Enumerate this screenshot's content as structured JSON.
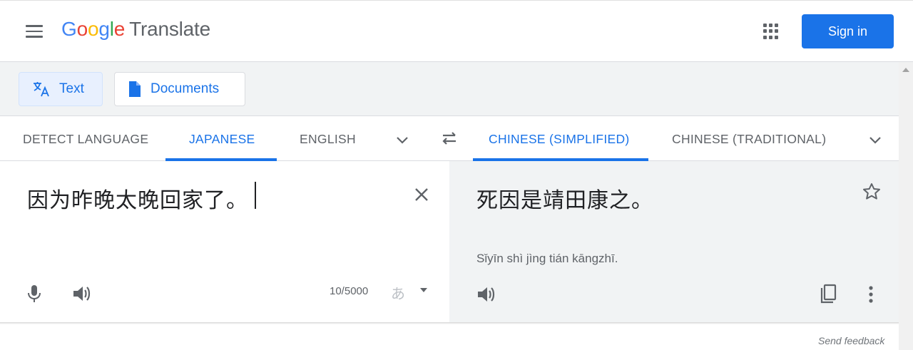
{
  "header": {
    "logo": {
      "g1": "G",
      "g2": "o",
      "g3": "o",
      "g4": "g",
      "g5": "l",
      "g6": "e",
      "product": "Translate"
    },
    "sign_in_label": "Sign in",
    "icons": {
      "menu": "hamburger-menu-icon",
      "apps": "apps-grid-icon"
    }
  },
  "modes": [
    {
      "label": "Text",
      "icon": "translate-icon",
      "active": true
    },
    {
      "label": "Documents",
      "icon": "document-icon",
      "active": false
    }
  ],
  "source_languages": [
    {
      "label": "DETECT LANGUAGE",
      "active": false
    },
    {
      "label": "JAPANESE",
      "active": true
    },
    {
      "label": "ENGLISH",
      "active": false
    }
  ],
  "target_languages": [
    {
      "label": "CHINESE (SIMPLIFIED)",
      "active": true
    },
    {
      "label": "CHINESE (TRADITIONAL)",
      "active": false
    }
  ],
  "source": {
    "text": "因为昨晚太晚回家了。",
    "char_count": "10/5000",
    "ime_label": "あ"
  },
  "target": {
    "text": "死因是靖田康之。",
    "romanization": "Sǐyīn shì jìng tián kāngzhī."
  },
  "footer": {
    "feedback_label": "Send feedback"
  },
  "colors": {
    "accent": "#1a73e8",
    "active_bg": "#e8f0fe",
    "panel_bg": "#f1f3f4",
    "text": "#3c4043",
    "muted": "#5f6368"
  }
}
